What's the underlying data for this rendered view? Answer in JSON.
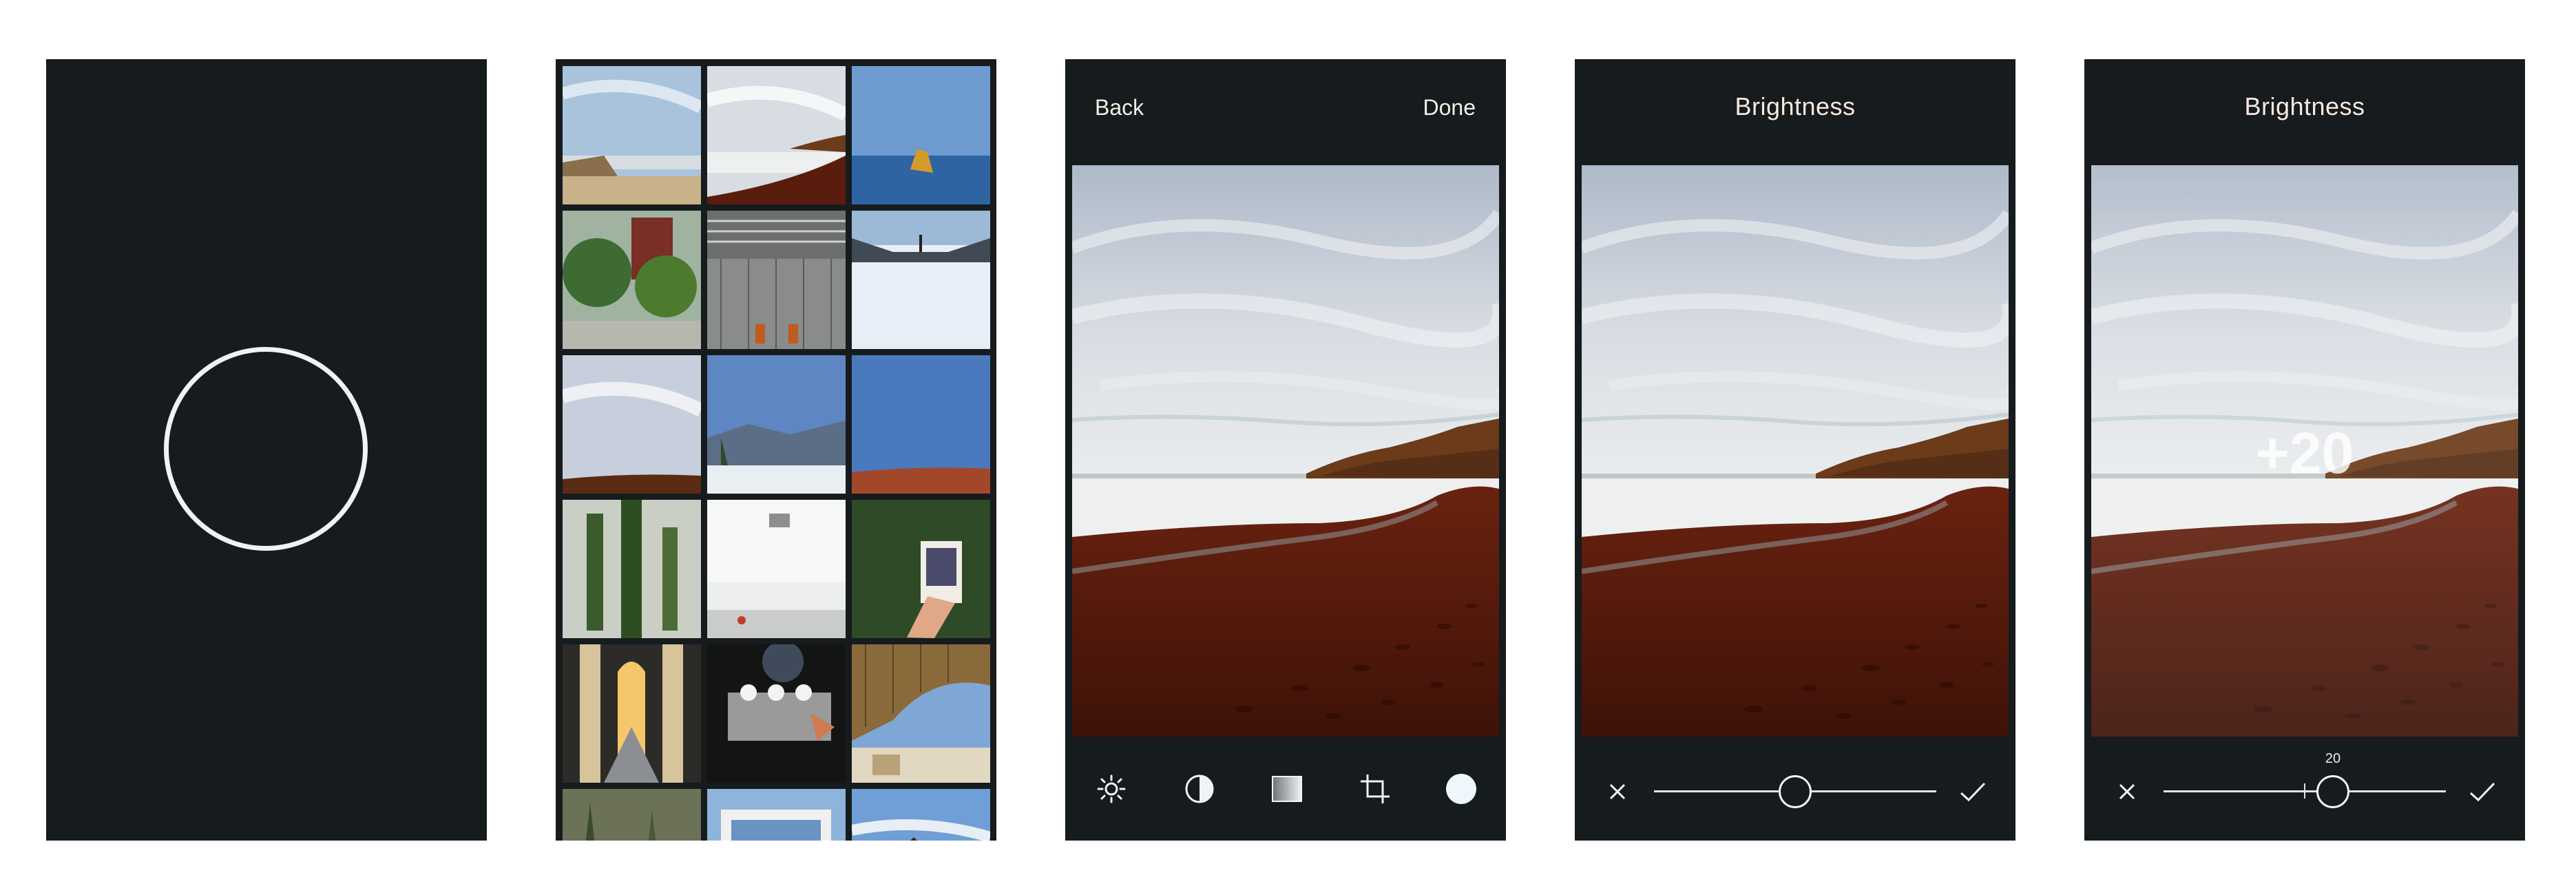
{
  "screens": {
    "camera": {
      "shutter_icon": "circle-shutter"
    },
    "gallery": {
      "rows": 6,
      "cols": 3
    },
    "edit": {
      "back_label": "Back",
      "done_label": "Done",
      "tools": [
        "sun-icon",
        "contrast-icon",
        "gradient-icon",
        "crop-icon",
        "circle-icon"
      ]
    },
    "brightness": {
      "title": "Brightness",
      "slider_value": 0,
      "slider_min": -100,
      "slider_max": 100
    },
    "brightness_adjusted": {
      "title": "Brightness",
      "overlay_value": "+20",
      "slider_label": "20",
      "slider_value": 20,
      "slider_min": -100,
      "slider_max": 100
    }
  },
  "colors": {
    "screen_bg": "#161b1e",
    "text_light": "#f3efe6",
    "title_text": "#f6e9dc",
    "sand": "#5a1c0d",
    "sky": "#cfd6de"
  }
}
